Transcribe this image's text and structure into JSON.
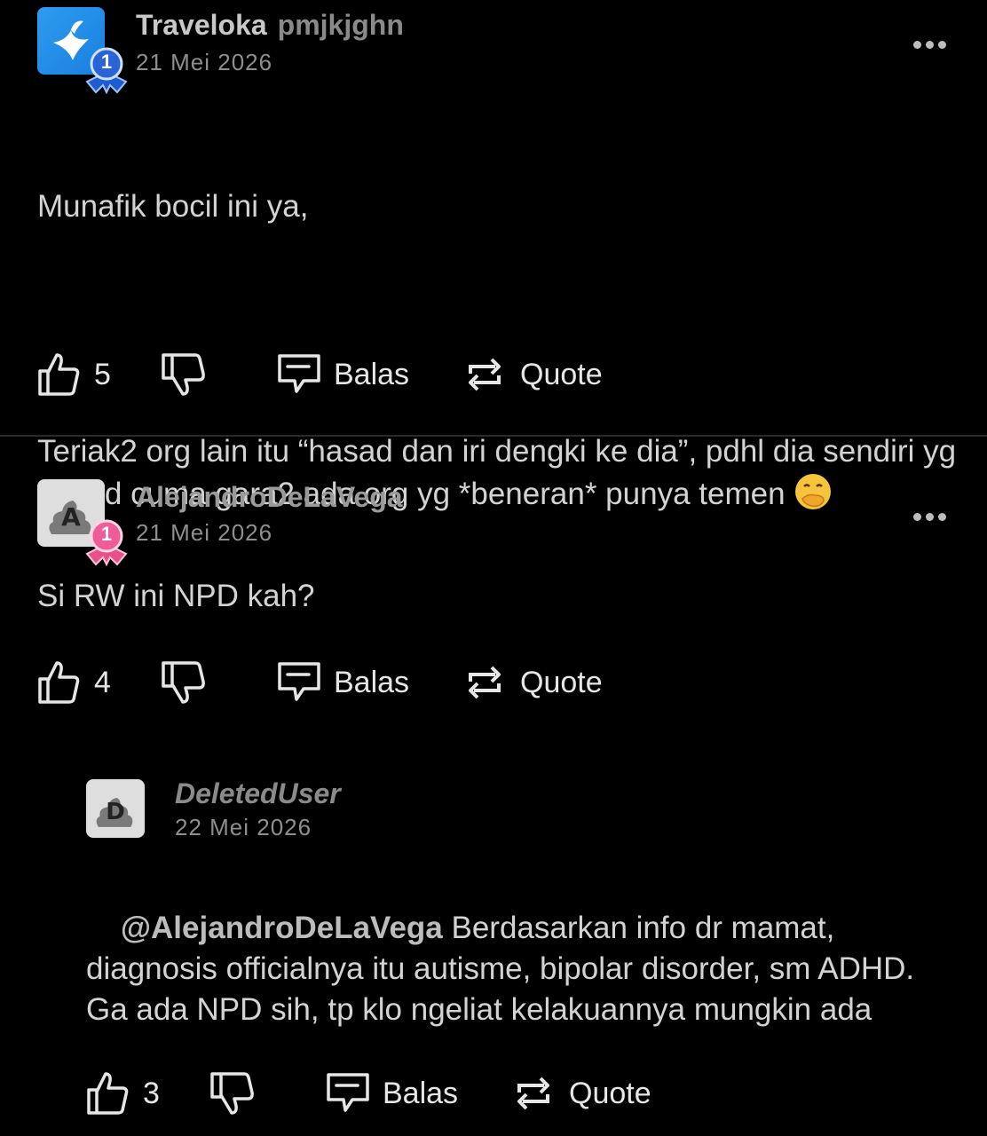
{
  "comments": [
    {
      "username": "Traveloka",
      "handle": "pmjkjghn",
      "date": "21 Mei 2026",
      "badge_number": "1",
      "avatar_type": "traveloka-bird",
      "text_p1": "Munafik bocil ini ya,",
      "text_p2": "Teriak2 org lain itu “hasad dan iri dengki ke dia”, pdhl dia sendiri yg hasad cuma gara2 ada org yg *beneran* punya temen ",
      "emoji": "face-with-hand-over-mouth",
      "likes": "5",
      "reply_label": "Balas",
      "quote_label": "Quote"
    },
    {
      "username": "AlejandroDeLaVega",
      "date": "21 Mei 2026",
      "avatar_letter": "A",
      "badge_number": "1",
      "text": "Si RW ini NPD kah?",
      "likes": "4",
      "reply_label": "Balas",
      "quote_label": "Quote"
    },
    {
      "username": "DeletedUser",
      "date": "22 Mei 2026",
      "avatar_letter": "D",
      "mention": "@AlejandroDeLaVega",
      "text": " Berdasarkan info dr mamat, diagnosis officialnya itu autisme, bipolar disorder, sm ADHD. Ga ada NPD sih, tp klo ngeliat kelakuannya mungkin ada",
      "likes": "3",
      "reply_label": "Balas",
      "quote_label": "Quote"
    }
  ],
  "colors": {
    "background": "#000000",
    "badge_blue": "#2a63d6",
    "badge_pink": "#ef5c96"
  }
}
